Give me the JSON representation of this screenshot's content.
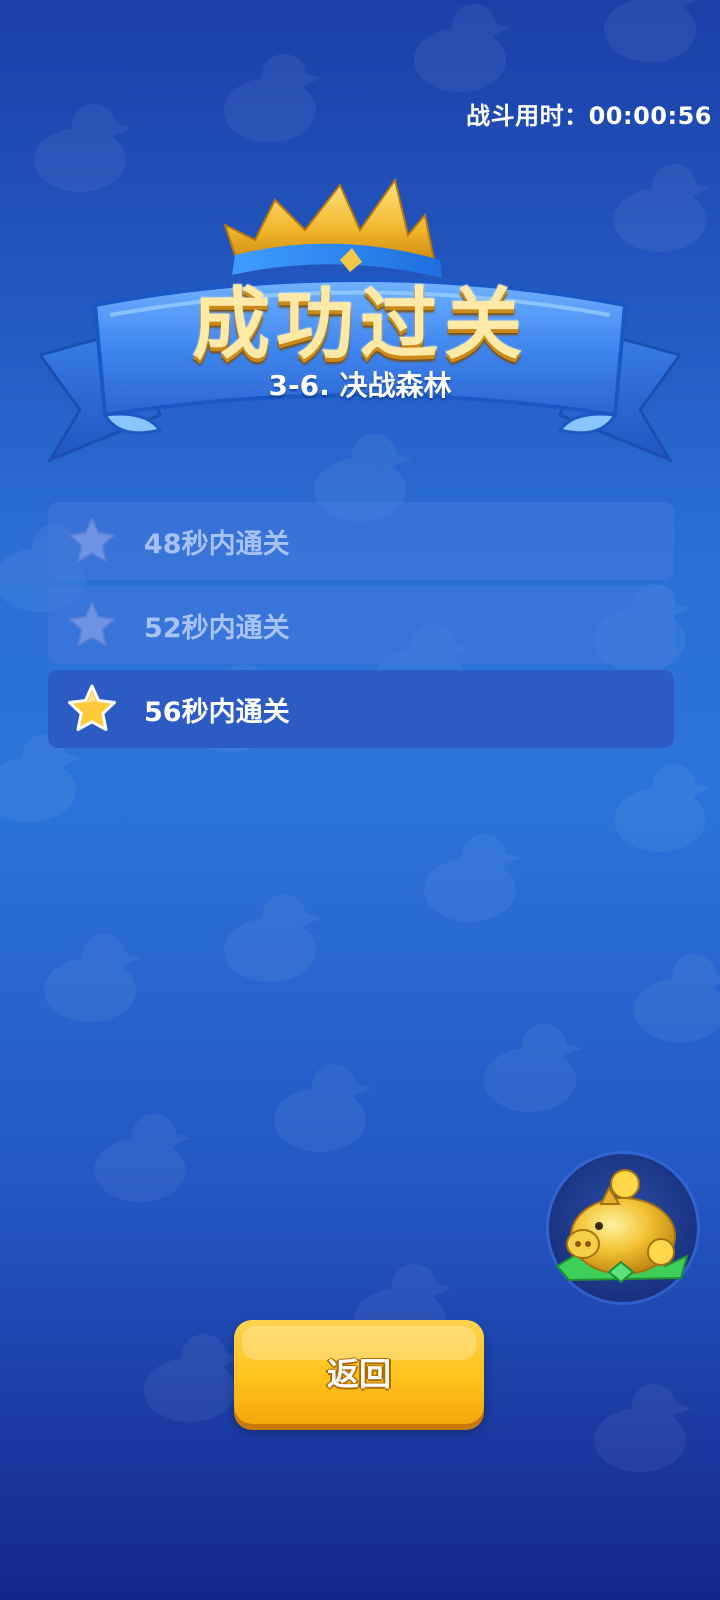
{
  "timer": {
    "label": "战斗用时：",
    "value": "00:00:56"
  },
  "banner": {
    "title": "成功过关",
    "subtitle": "3-6. 决战森林"
  },
  "objectives": [
    {
      "text": "48秒内通关",
      "achieved": false
    },
    {
      "text": "52秒内通关",
      "achieved": false
    },
    {
      "text": "56秒内通关",
      "achieved": true
    }
  ],
  "back_button": {
    "label": "返回"
  },
  "icons": {
    "crown": "crown-icon",
    "star": "star-icon",
    "piggy_bank": "piggy-bank-icon",
    "duck_pattern": "duck-icon"
  },
  "colors": {
    "background_top": "#1b3fa8",
    "background_mid": "#2a6fd6",
    "background_bottom": "#14268a",
    "title_gold": "#ffe9a6",
    "button_yellow": "#ffc21a",
    "star_gold": "#ffc93a",
    "star_inactive": "#6f94e6"
  }
}
